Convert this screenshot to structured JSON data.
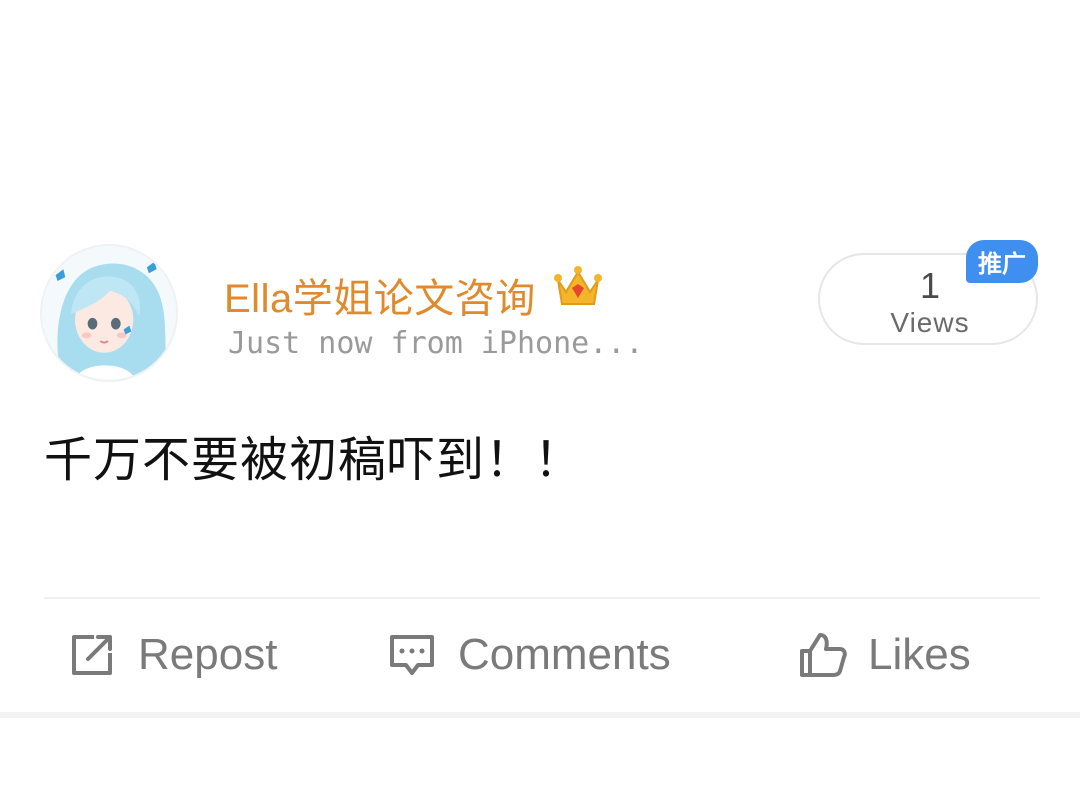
{
  "post": {
    "user_name": "Ella学姐论文咨询",
    "meta": "Just now from iPhone...",
    "views_count": "1",
    "views_label": "Views",
    "promo_badge": "推广",
    "text": "千万不要被初稿吓到！！"
  },
  "actions": {
    "repost": "Repost",
    "comments": "Comments",
    "likes": "Likes"
  },
  "colors": {
    "user_name": "#e08a2c",
    "promo_badge": "#3e8ff0",
    "meta_text": "#9a9a9a",
    "action_text": "#7a7a7a"
  },
  "icons": {
    "avatar": "anime-girl-avatar",
    "badge": "crown-icon",
    "repost": "repost-icon",
    "comments": "comment-icon",
    "likes": "thumbs-up-icon"
  }
}
